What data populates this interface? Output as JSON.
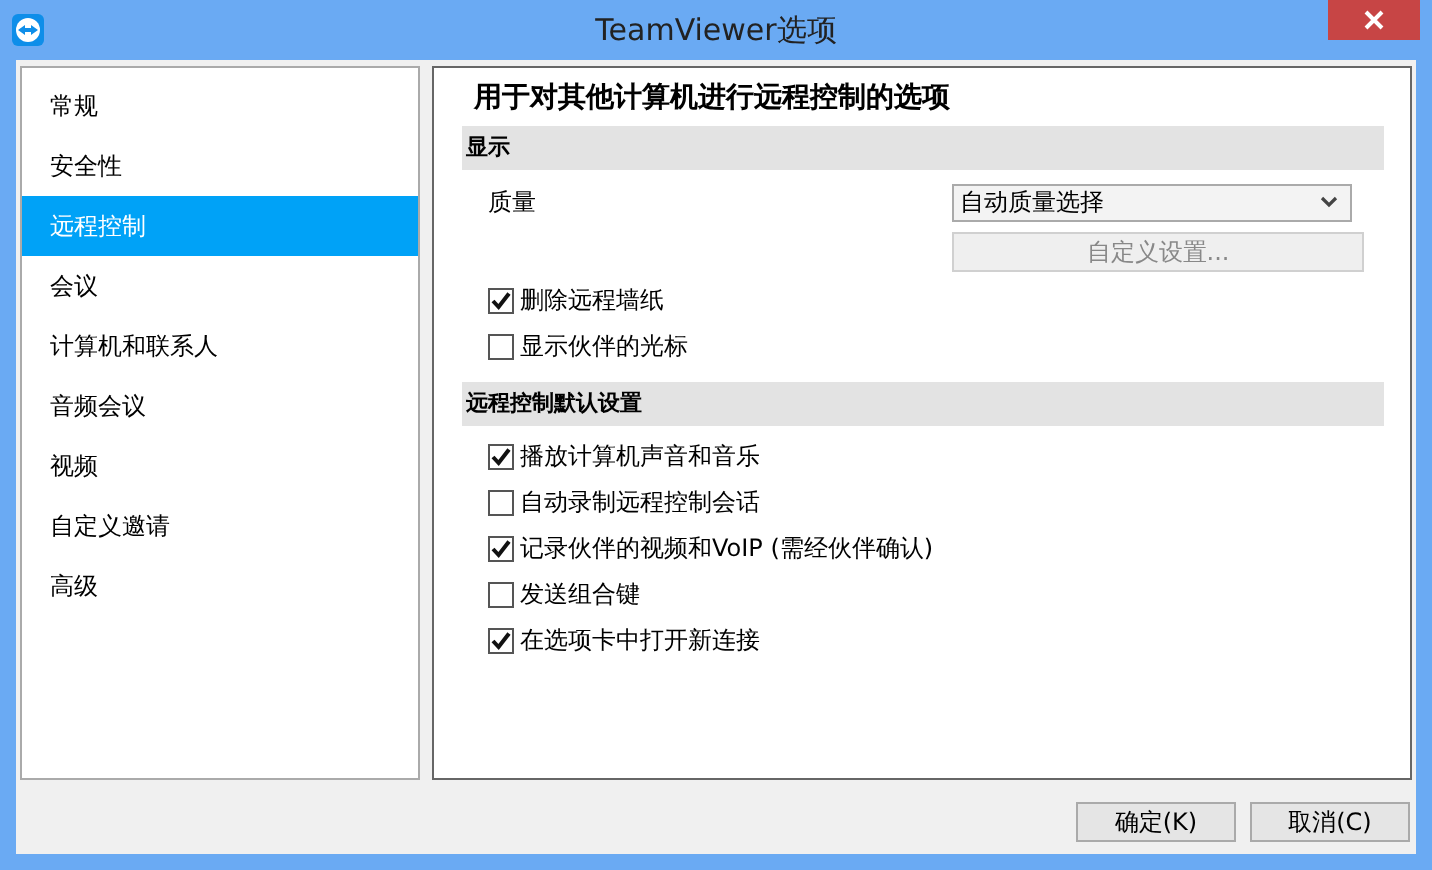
{
  "window": {
    "title": "TeamViewer选项"
  },
  "sidebar": {
    "items": [
      {
        "label": "常规",
        "selected": false
      },
      {
        "label": "安全性",
        "selected": false
      },
      {
        "label": "远程控制",
        "selected": true
      },
      {
        "label": "会议",
        "selected": false
      },
      {
        "label": "计算机和联系人",
        "selected": false
      },
      {
        "label": "音频会议",
        "selected": false
      },
      {
        "label": "视频",
        "selected": false
      },
      {
        "label": "自定义邀请",
        "selected": false
      },
      {
        "label": "高级",
        "selected": false
      }
    ]
  },
  "panel": {
    "title": "用于对其他计算机进行远程控制的选项",
    "sections": [
      {
        "heading": "显示",
        "items": [
          {
            "kind": "select",
            "label": "质量",
            "value": "自动质量选择"
          },
          {
            "kind": "button",
            "label": "自定义设置...",
            "disabled": true
          },
          {
            "kind": "checkbox",
            "label": "删除远程墙纸",
            "checked": true
          },
          {
            "kind": "checkbox",
            "label": "显示伙伴的光标",
            "checked": false
          }
        ]
      },
      {
        "heading": "远程控制默认设置",
        "items": [
          {
            "kind": "checkbox",
            "label": "播放计算机声音和音乐",
            "checked": true
          },
          {
            "kind": "checkbox",
            "label": "自动录制远程控制会话",
            "checked": false
          },
          {
            "kind": "checkbox",
            "label": "记录伙伴的视频和VoIP (需经伙伴确认)",
            "checked": true
          },
          {
            "kind": "checkbox",
            "label": "发送组合键",
            "checked": false
          },
          {
            "kind": "checkbox",
            "label": "在选项卡中打开新连接",
            "checked": true
          }
        ]
      }
    ]
  },
  "buttons": [
    {
      "label": "确定(K)"
    },
    {
      "label": "取消(C)"
    }
  ]
}
